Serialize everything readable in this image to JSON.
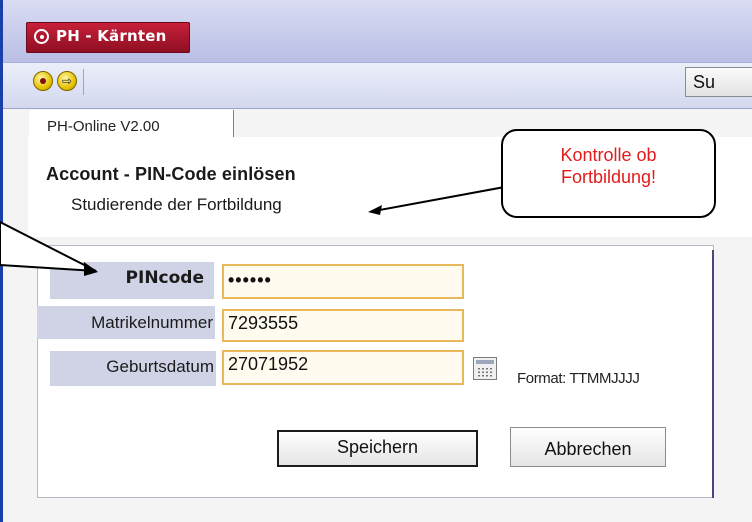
{
  "window": {
    "title": "PH - Kärnten"
  },
  "toolbar": {
    "search_label": "Su"
  },
  "tab": {
    "label": "PH-Online V2.00"
  },
  "page": {
    "title": "Account - PIN-Code einlösen",
    "subtitle": "Studierende der Fortbildung"
  },
  "form": {
    "pin": {
      "label": "PINcode",
      "value": "••••••"
    },
    "matrikel": {
      "label": "Matrikelnummer",
      "value": "7293555"
    },
    "geburtsdatum": {
      "label": "Geburtsdatum",
      "value": "27071952",
      "format_hint": "Format: TTMMJJJJ"
    },
    "save_label": "Speichern",
    "cancel_label": "Abbrechen"
  },
  "callout": {
    "line1": "Kontrolle ob",
    "line2": "Fortbildung!"
  },
  "colors": {
    "title_red": "#a8142c",
    "accent_blue": "#1a3fa8",
    "callout_text": "#e21b1b",
    "input_border": "#e8b85a"
  },
  "icons": [
    "app-logo-icon",
    "back-icon",
    "forward-arrow-icon",
    "calendar-icon"
  ]
}
